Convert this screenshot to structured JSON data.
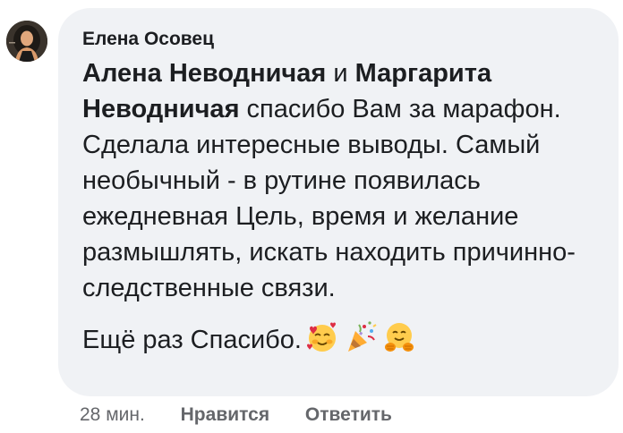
{
  "comment": {
    "author": "Елена Осовец",
    "mention1": "Алена Неводничая",
    "conjunction": " и ",
    "mention2": "Маргарита Неводничая",
    "body": " спасибо Вам за марафон. Сделала интересные выводы. Самый необычный - в рутине появилась ежедневная Цель, время и желание размышлять, искать находить причинно-следственные связи.",
    "thanks": "Ещё раз Спасибо.",
    "emojis": [
      "smiling-face-with-hearts-icon",
      "party-popper-icon",
      "hugging-face-icon"
    ]
  },
  "footer": {
    "time": "28 мин.",
    "like": "Нравится",
    "reply": "Ответить"
  },
  "colors": {
    "bubble": "#f0f2f5",
    "text": "#1c1e21",
    "meta": "#65676b"
  }
}
